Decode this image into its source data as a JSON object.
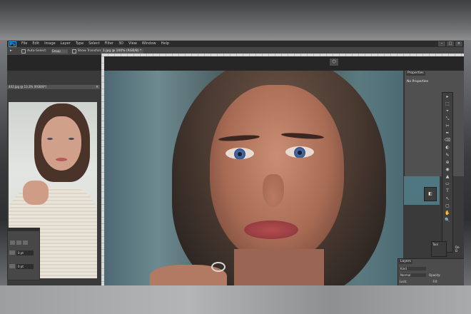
{
  "app": {
    "logo": "Ps",
    "menu": [
      "File",
      "Edit",
      "Image",
      "Layer",
      "Type",
      "Select",
      "Filter",
      "3D",
      "View",
      "Window",
      "Help"
    ],
    "window_buttons": [
      "–",
      "□",
      "✕"
    ]
  },
  "options_bar": {
    "tool_icon": "move-tool-icon",
    "auto_select_label": "Auto-Select:",
    "auto_select_value": "Group",
    "show_transform_label": "Show Transform"
  },
  "document": {
    "tab_title": "1.jpg @ 100% (RGB/8) *",
    "secondary_tab_title": "443.jpg @ 13.3% (RGB/8*)"
  },
  "left_panel": {
    "field1": "0 pt",
    "field2": "0 pt"
  },
  "properties": {
    "tab_label": "Properties",
    "content": "No Properties"
  },
  "tools": [
    "▸",
    "⬚",
    "⌖",
    "⤡",
    "✂",
    "✒",
    "⌫",
    "◐",
    "✎",
    "⊕",
    "◉",
    "▲",
    "▭",
    "T",
    "↖",
    "▢",
    "✋",
    "🔍"
  ],
  "small_panel": {
    "label": "Tool"
  },
  "layers": {
    "tab_label": "Layers",
    "kind_label": "Kind",
    "mode_label": "Normal",
    "opacity_label": "Opacity:",
    "lock_label": "Lock:",
    "fill_label": "Fill:"
  },
  "right_edge": {
    "line1": "De",
    "line2": "D"
  }
}
